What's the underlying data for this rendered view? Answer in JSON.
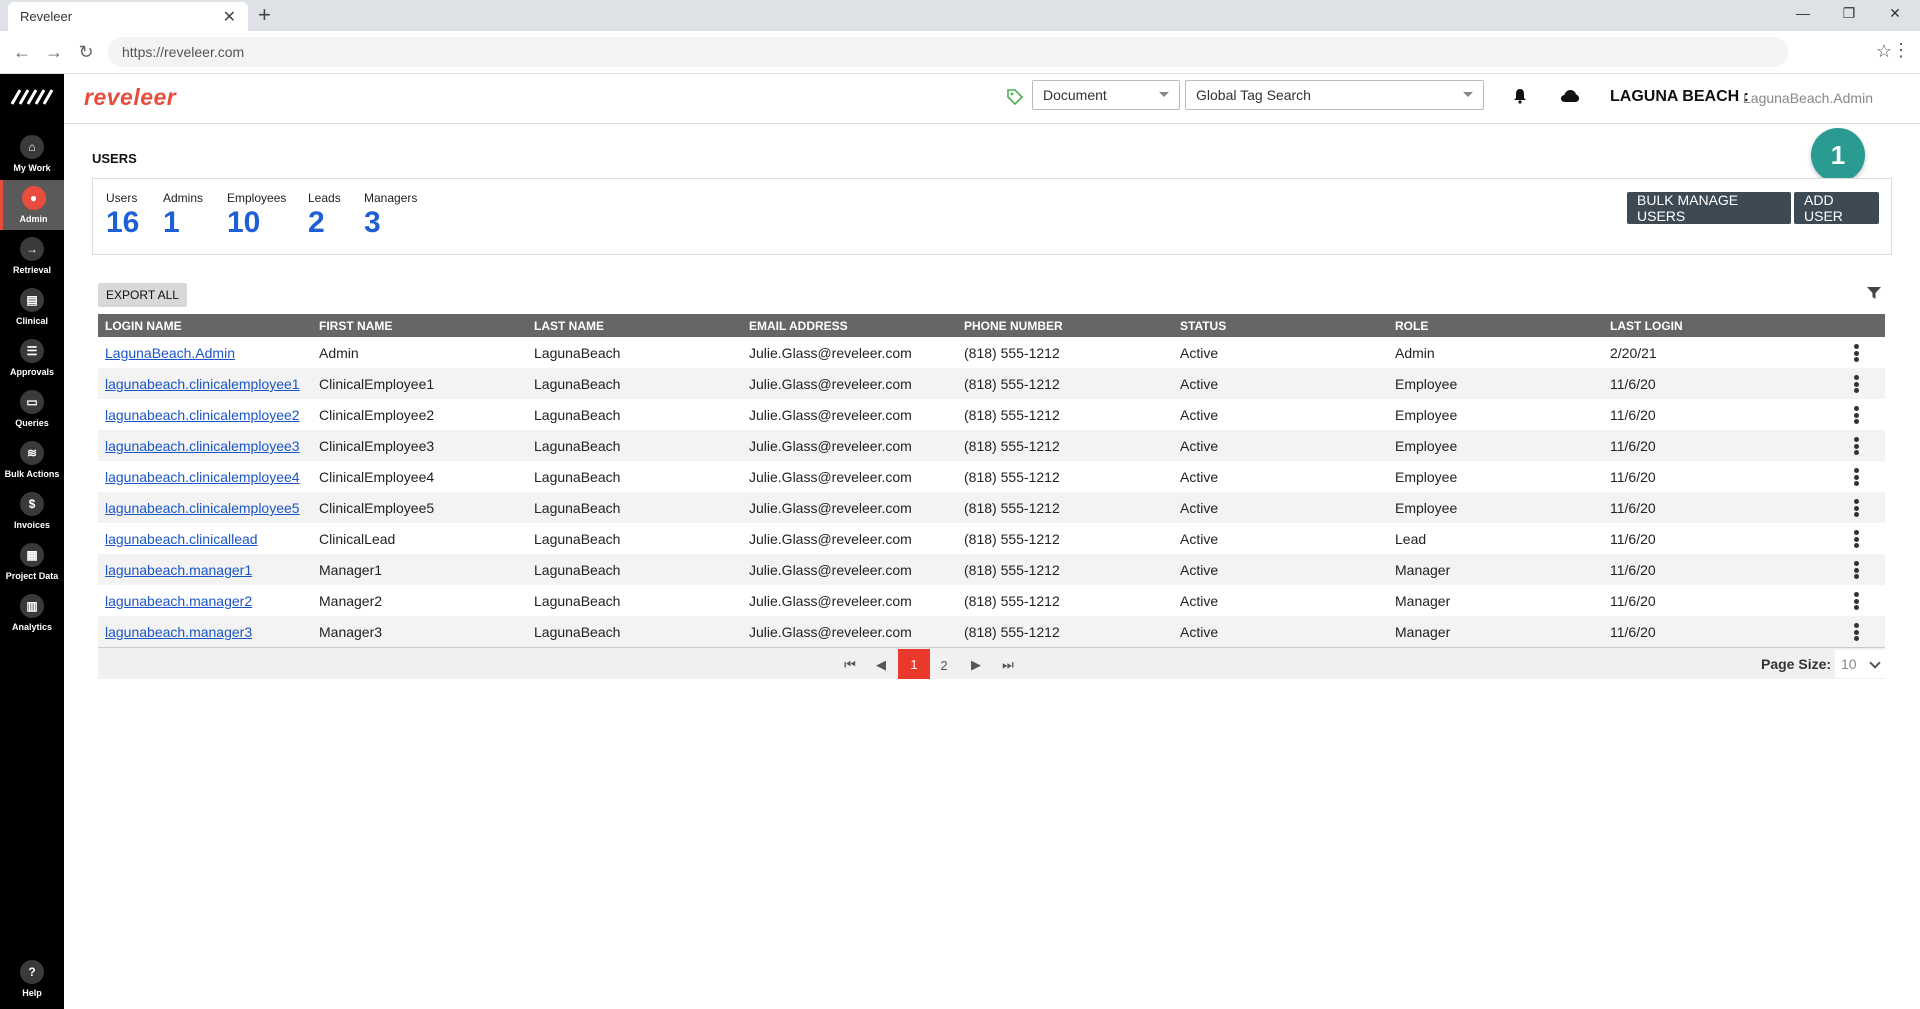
{
  "browser": {
    "tab_title": "Reveleer",
    "tab_close": "✕",
    "new_tab": "+",
    "url": "https://reveleer.com"
  },
  "sidebar": {
    "items": [
      {
        "label": "My Work",
        "icon": "home-icon",
        "glyph": "⌂"
      },
      {
        "label": "Admin",
        "icon": "admin-icon",
        "glyph": "●"
      },
      {
        "label": "Retrieval",
        "icon": "retrieval-icon",
        "glyph": "→"
      },
      {
        "label": "Clinical",
        "icon": "clinical-icon",
        "glyph": "▤"
      },
      {
        "label": "Approvals",
        "icon": "approvals-icon",
        "glyph": "☰"
      },
      {
        "label": "Queries",
        "icon": "queries-icon",
        "glyph": "▭"
      },
      {
        "label": "Bulk Actions",
        "icon": "bulk-actions-icon",
        "glyph": "≋"
      },
      {
        "label": "Invoices",
        "icon": "invoices-icon",
        "glyph": "$"
      },
      {
        "label": "Project Data",
        "icon": "project-data-icon",
        "glyph": "▦"
      },
      {
        "label": "Analytics",
        "icon": "analytics-icon",
        "glyph": "▥"
      }
    ],
    "help": {
      "label": "Help",
      "glyph": "?"
    }
  },
  "header": {
    "brand": "reveleer",
    "document_select": "Document",
    "tag_search": "Global Tag Search",
    "org": "LAGUNA BEACH :",
    "user": "LagunaBeach.Admin"
  },
  "page": {
    "title": "USERS",
    "step_badge": "1",
    "stats": [
      {
        "label": "Users",
        "value": "16"
      },
      {
        "label": "Admins",
        "value": "1"
      },
      {
        "label": "Employees",
        "value": "10"
      },
      {
        "label": "Leads",
        "value": "2"
      },
      {
        "label": "Managers",
        "value": "3"
      }
    ],
    "bulk_manage_label": "BULK MANAGE USERS",
    "add_user_label": "ADD USER",
    "export_all_label": "EXPORT ALL"
  },
  "table": {
    "columns": [
      "LOGIN NAME",
      "FIRST NAME",
      "LAST NAME",
      "EMAIL ADDRESS",
      "PHONE NUMBER",
      "STATUS",
      "ROLE",
      "LAST LOGIN"
    ],
    "rows": [
      [
        "LagunaBeach.Admin",
        "Admin",
        "LagunaBeach",
        "Julie.Glass@reveleer.com",
        "(818) 555-1212",
        "Active",
        "Admin",
        "2/20/21"
      ],
      [
        "lagunabeach.clinicalemployee1",
        "ClinicalEmployee1",
        "LagunaBeach",
        "Julie.Glass@reveleer.com",
        "(818) 555-1212",
        "Active",
        "Employee",
        "11/6/20"
      ],
      [
        "lagunabeach.clinicalemployee2",
        "ClinicalEmployee2",
        "LagunaBeach",
        "Julie.Glass@reveleer.com",
        "(818) 555-1212",
        "Active",
        "Employee",
        "11/6/20"
      ],
      [
        "lagunabeach.clinicalemployee3",
        "ClinicalEmployee3",
        "LagunaBeach",
        "Julie.Glass@reveleer.com",
        "(818) 555-1212",
        "Active",
        "Employee",
        "11/6/20"
      ],
      [
        "lagunabeach.clinicalemployee4",
        "ClinicalEmployee4",
        "LagunaBeach",
        "Julie.Glass@reveleer.com",
        "(818) 555-1212",
        "Active",
        "Employee",
        "11/6/20"
      ],
      [
        "lagunabeach.clinicalemployee5",
        "ClinicalEmployee5",
        "LagunaBeach",
        "Julie.Glass@reveleer.com",
        "(818) 555-1212",
        "Active",
        "Employee",
        "11/6/20"
      ],
      [
        "lagunabeach.clinicallead",
        "ClinicalLead",
        "LagunaBeach",
        "Julie.Glass@reveleer.com",
        "(818) 555-1212",
        "Active",
        "Lead",
        "11/6/20"
      ],
      [
        "lagunabeach.manager1",
        "Manager1",
        "LagunaBeach",
        "Julie.Glass@reveleer.com",
        "(818) 555-1212",
        "Active",
        "Manager",
        "11/6/20"
      ],
      [
        "lagunabeach.manager2",
        "Manager2",
        "LagunaBeach",
        "Julie.Glass@reveleer.com",
        "(818) 555-1212",
        "Active",
        "Manager",
        "11/6/20"
      ],
      [
        "lagunabeach.manager3",
        "Manager3",
        "LagunaBeach",
        "Julie.Glass@reveleer.com",
        "(818) 555-1212",
        "Active",
        "Manager",
        "11/6/20"
      ]
    ]
  },
  "pager": {
    "first": "⏮",
    "prev": "◀",
    "next": "▶",
    "last": "⏭",
    "pages": [
      "1",
      "2"
    ],
    "current_page": "1",
    "page_size_label": "Page Size:",
    "page_size_value": "10"
  },
  "colors": {
    "brand": "#e84c3d",
    "stat_value": "#1f5fd6",
    "header_bg": "#666666",
    "button_dark": "#3d4a54",
    "badge": "#2a9b91"
  }
}
